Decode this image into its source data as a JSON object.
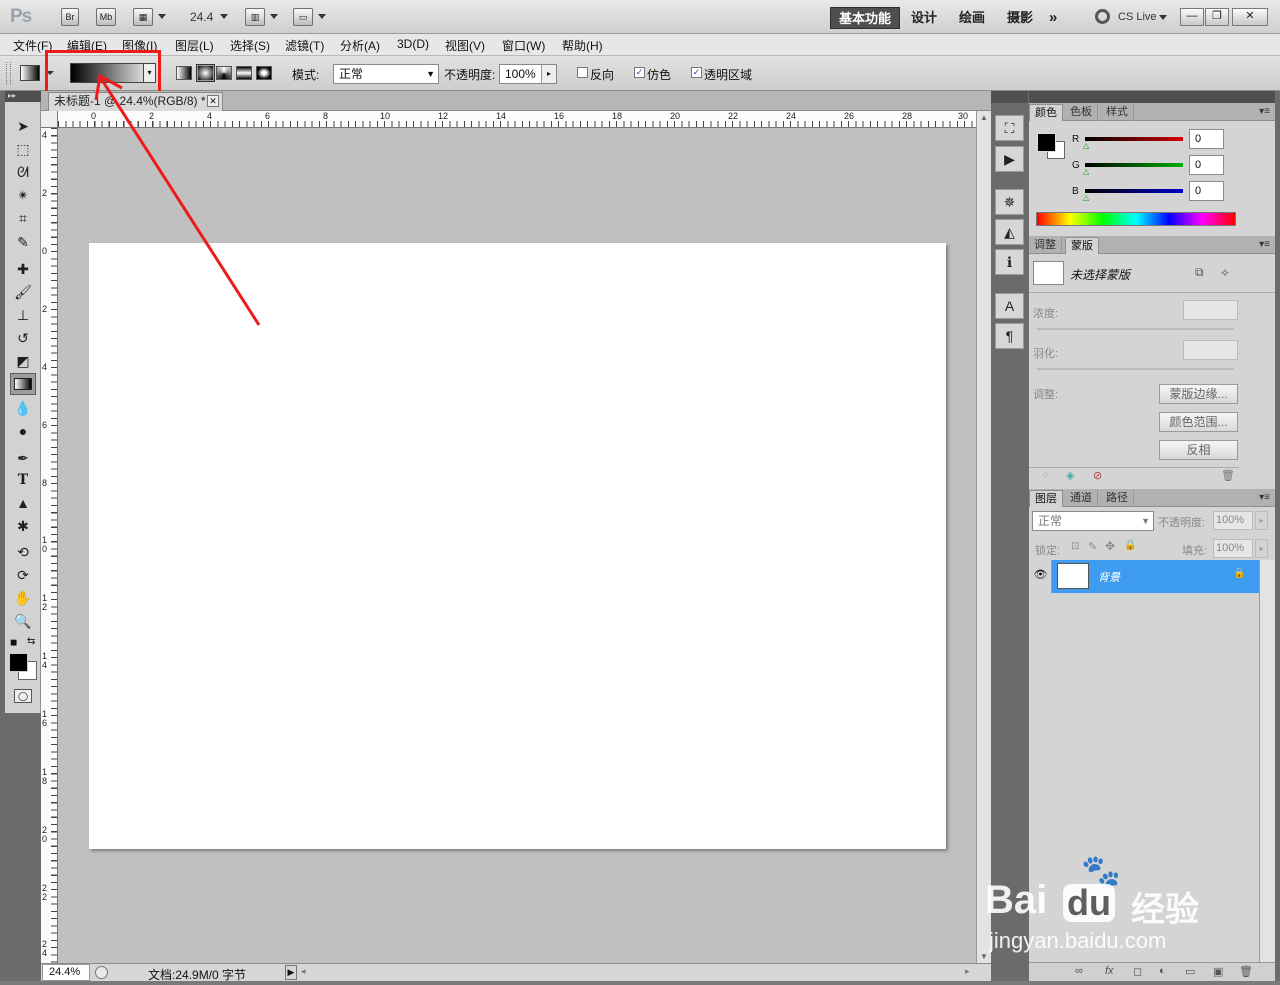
{
  "app": {
    "logo": "Ps",
    "bridge": "Br",
    "minibridge": "Mb",
    "zoom": "24.4",
    "workspaces": [
      "基本功能",
      "设计",
      "绘画",
      "摄影"
    ],
    "more": "»",
    "cslive": "CS Live",
    "window_controls": [
      "—",
      "❐",
      "✕"
    ]
  },
  "menu": [
    "文件(F)",
    "编辑(E)",
    "图像(I)",
    "图层(L)",
    "选择(S)",
    "滤镜(T)",
    "分析(A)",
    "3D(D)",
    "视图(V)",
    "窗口(W)",
    "帮助(H)"
  ],
  "options": {
    "mode_label": "模式:",
    "mode_value": "正常",
    "opacity_label": "不透明度:",
    "opacity_value": "100%",
    "reverse": "反向",
    "dither": "仿色",
    "transparency": "透明区域",
    "reverse_checked": false,
    "dither_checked": true,
    "transparency_checked": true
  },
  "document": {
    "tab_title": "未标题-1 @ 24.4%(RGB/8) *",
    "ruler_h": [
      "0",
      "2",
      "4",
      "6",
      "8",
      "10",
      "12",
      "14",
      "16",
      "18",
      "20",
      "22",
      "24",
      "26",
      "28",
      "30"
    ],
    "ruler_v": [
      "4",
      "2",
      "0",
      "2",
      "4",
      "6",
      "8",
      "10",
      "12",
      "14",
      "16",
      "18",
      "20",
      "22",
      "24"
    ]
  },
  "status": {
    "zoom": "24.4%",
    "doc": "文档:24.9M/0 字节"
  },
  "color_panel": {
    "tabs": [
      "颜色",
      "色板",
      "样式"
    ],
    "channels": [
      {
        "name": "R",
        "value": "0",
        "color": "#d40000"
      },
      {
        "name": "G",
        "value": "0",
        "color": "#00b000"
      },
      {
        "name": "B",
        "value": "0",
        "color": "#0000cc"
      }
    ]
  },
  "masks_panel": {
    "tabs": [
      "调整",
      "蒙版"
    ],
    "no_mask": "未选择蒙版",
    "density": "浓度:",
    "feather": "羽化:",
    "refine": "调整:",
    "buttons": [
      "蒙版边缘...",
      "颜色范围...",
      "反相"
    ]
  },
  "layers_panel": {
    "tabs": [
      "图层",
      "通道",
      "路径"
    ],
    "blend": "正常",
    "opacity_label": "不透明度:",
    "opacity": "100%",
    "lock_label": "锁定:",
    "fill_label": "填充:",
    "fill": "100%",
    "layer_name": "背景",
    "footer_icons": [
      "∞",
      "fx",
      "◻",
      "◐",
      "▭",
      "▣",
      "🗑"
    ]
  },
  "colors": {
    "accent_highlight": "#ee1b1b",
    "layer_selected": "#3d9cf0"
  },
  "watermark": {
    "brand": "Bai",
    "brand2": "du",
    "cn": "经验",
    "url": "jingyan.baidu.com"
  }
}
